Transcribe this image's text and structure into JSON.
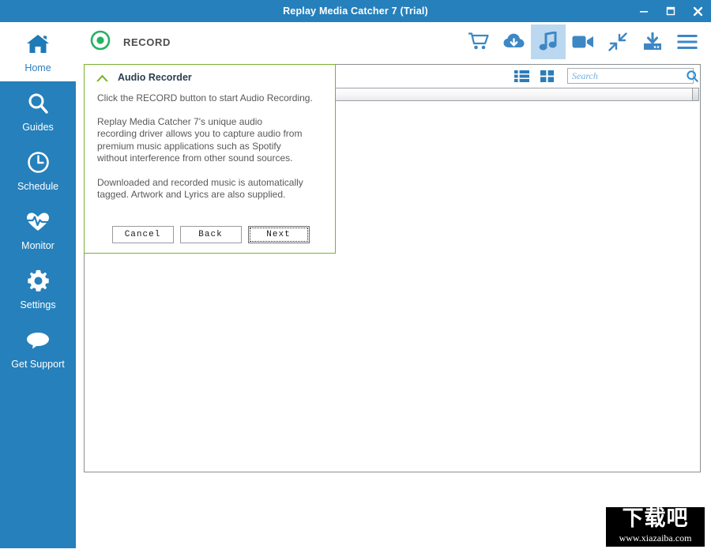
{
  "window": {
    "title": "Replay Media Catcher 7 (Trial)",
    "titlebar_color": "#2680bb",
    "controls": [
      {
        "name": "minimize",
        "label": "–"
      },
      {
        "name": "maximize",
        "label": "❐"
      },
      {
        "name": "close",
        "label": "✕"
      }
    ]
  },
  "sidebar": {
    "background": "#2680bb",
    "items": [
      {
        "label": "Home",
        "icon": "home-icon",
        "active": true
      },
      {
        "label": "Guides",
        "icon": "search-icon",
        "active": false
      },
      {
        "label": "Schedule",
        "icon": "clock-icon",
        "active": false
      },
      {
        "label": "Monitor",
        "icon": "heartbeat-icon",
        "active": false
      },
      {
        "label": "Settings",
        "icon": "gear-icon",
        "active": false
      },
      {
        "label": "Get Support",
        "icon": "speech-bubble-icon",
        "active": false
      }
    ]
  },
  "topbar": {
    "record_label": "RECORD",
    "record_icon": "record-circle-icon",
    "record_icon_color": "#25b263",
    "icons": [
      {
        "name": "cart-icon",
        "selected": false
      },
      {
        "name": "cloud-download-icon",
        "selected": false
      },
      {
        "name": "music-note-icon",
        "selected": true
      },
      {
        "name": "video-camera-icon",
        "selected": false
      },
      {
        "name": "collapse-arrows-icon",
        "selected": false
      },
      {
        "name": "download-tray-icon",
        "selected": false
      },
      {
        "name": "hamburger-menu-icon",
        "selected": false
      }
    ],
    "icon_color": "#3d87c4",
    "selected_background": "#bcd8f0"
  },
  "content": {
    "view_list_icon": "list-view-icon",
    "view_grid_icon": "grid-view-icon",
    "search": {
      "placeholder": "Search",
      "value": "",
      "icon": "search-magnifier-icon"
    }
  },
  "dialog": {
    "title": "Audio Recorder",
    "collapse_icon": "chevron-up-icon",
    "accent_color": "#7cb02e",
    "paragraphs": [
      "Click the RECORD button to start Audio Recording.",
      "Replay Media Catcher 7's unique audio recording driver allows you to capture audio from premium music applications such as Spotify without interference from other sound sources.",
      "Downloaded and recorded music is automatically tagged. Artwork and Lyrics are also supplied."
    ],
    "buttons": [
      {
        "label": "Cancel",
        "focused": false
      },
      {
        "label": "Back",
        "focused": false
      },
      {
        "label": "Next",
        "focused": true
      }
    ]
  },
  "watermark": {
    "text_cn": "下载吧",
    "url": "www.xiazaiba.com"
  }
}
